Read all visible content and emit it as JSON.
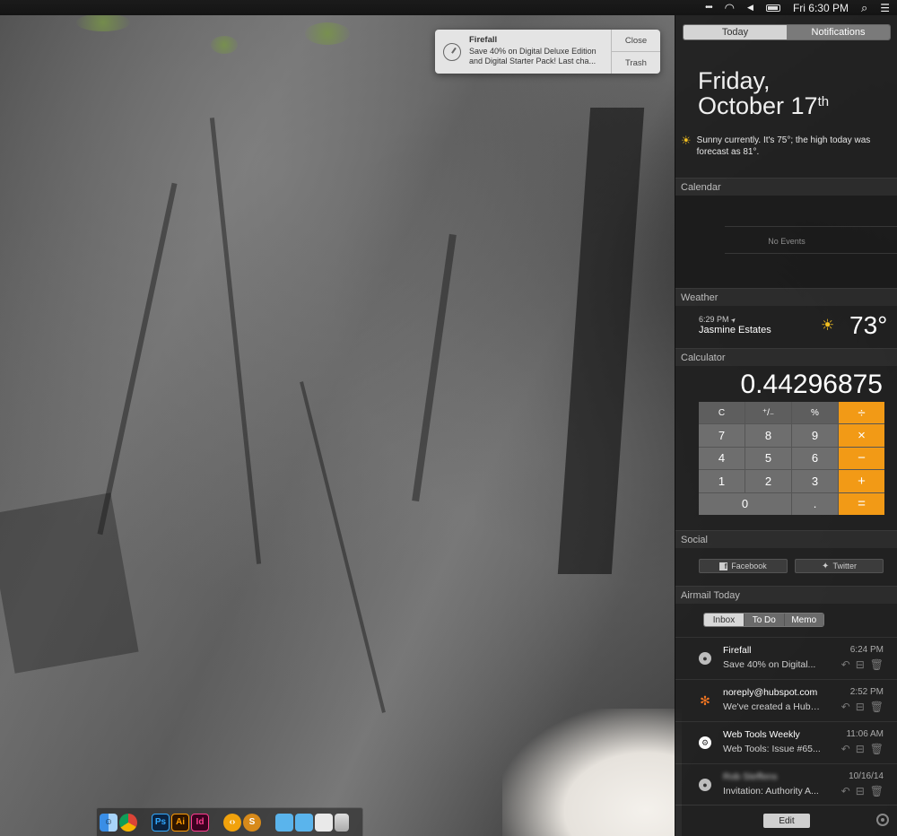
{
  "menubar": {
    "more_glyph": "•••",
    "wifi_glyph": "◠",
    "volume_glyph": "◀",
    "clock": "Fri 6:30 PM",
    "search_glyph": "⌕",
    "list_glyph": "☰"
  },
  "banner": {
    "app": "Firefall",
    "line1": "Save 40% on Digital Deluxe Edition",
    "line2": "and Digital Starter Pack! Last cha...",
    "close_label": "Close",
    "trash_label": "Trash"
  },
  "nc": {
    "tabs": [
      {
        "label": "Today",
        "active": true
      },
      {
        "label": "Notifications",
        "active": false
      }
    ],
    "date_line1": "Friday,",
    "date_line2": "October 17",
    "date_suffix": "th",
    "weather_summary": "Sunny currently. It's 75°; the high today was forecast as 81°.",
    "sun_glyph": "☀",
    "calendar": {
      "title": "Calendar",
      "empty_text": "No Events"
    },
    "weather": {
      "title": "Weather",
      "time": "6:29 PM",
      "location_arrow": "➤",
      "place": "Jasmine Estates",
      "temp": "73°"
    },
    "calculator": {
      "title": "Calculator",
      "display": "0.44296875",
      "keys": [
        "C",
        "⁺/₋",
        "%",
        "÷",
        "7",
        "8",
        "9",
        "×",
        "4",
        "5",
        "6",
        "−",
        "1",
        "2",
        "3",
        "+",
        "0",
        ".",
        "="
      ]
    },
    "social": {
      "title": "Social",
      "facebook_icon": "f",
      "facebook": "Facebook",
      "twitter_icon": "✦",
      "twitter": "Twitter"
    },
    "airmail": {
      "title": "Airmail Today",
      "tabs": [
        "Inbox",
        "To Do",
        "Memo"
      ],
      "reply_glyph": "↶",
      "archive_glyph": "⊟",
      "trash_glyph": "🗑",
      "messages": [
        {
          "from": "Firefall",
          "preview": "Save 40% on Digital...",
          "time": "6:24 PM",
          "avatar": "person"
        },
        {
          "from": "noreply@hubspot.com",
          "preview": "We've created a HubS...",
          "time": "2:52 PM",
          "avatar": "hubspot"
        },
        {
          "from": "Web Tools Weekly",
          "preview": "Web Tools: Issue #65...",
          "time": "11:06 AM",
          "avatar": "webtools"
        },
        {
          "from": "Rob Steffens",
          "preview": "Invitation: Authority A...",
          "time": "10/16/14",
          "avatar": "person"
        }
      ]
    },
    "edit_label": "Edit"
  },
  "dock": {
    "finder_glyph": "☺",
    "photoshop": "Ps",
    "illustrator": "Ai",
    "indesign": "Id",
    "code_glyph": "‹›",
    "sublime_glyph": "S"
  }
}
